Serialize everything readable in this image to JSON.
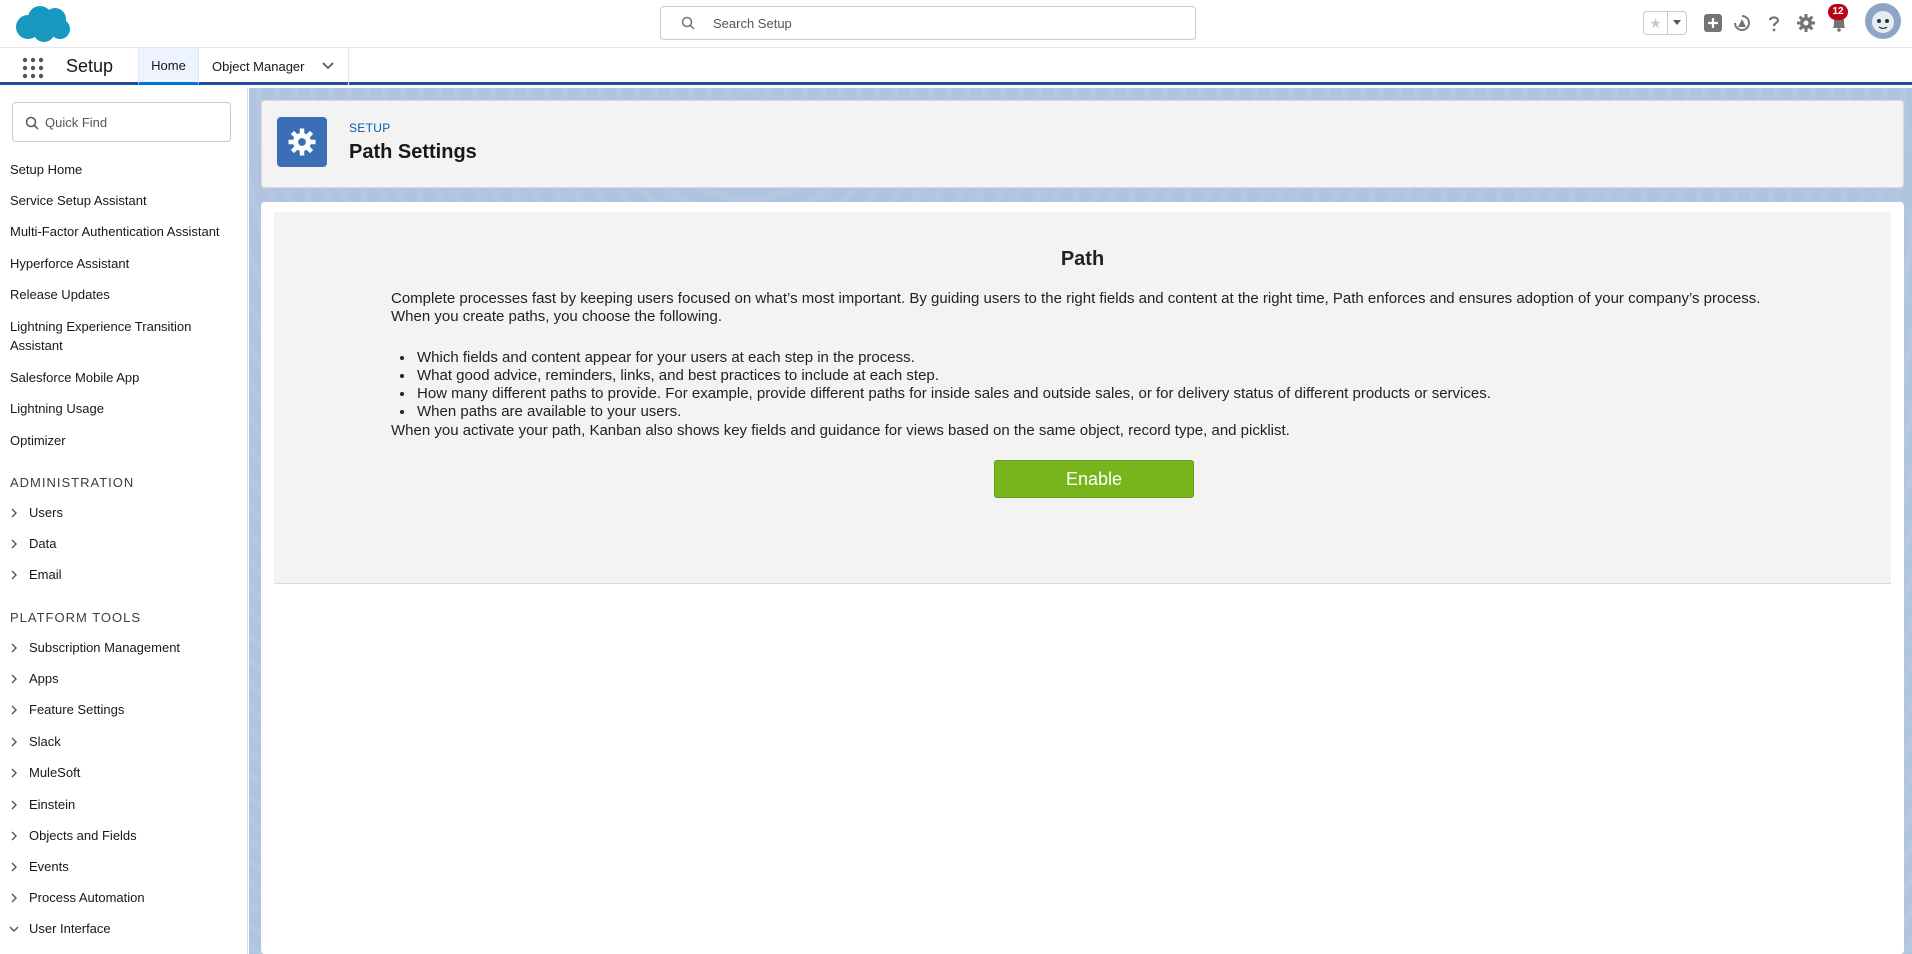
{
  "header": {
    "search_placeholder": "Search Setup",
    "notification_count": "12",
    "icons": [
      "salesforce-cloud-logo",
      "search-icon",
      "favorites-star-icon",
      "chevron-down-icon",
      "add-icon",
      "trailhead-icon",
      "help-icon",
      "gear-icon",
      "bell-icon",
      "avatar"
    ]
  },
  "app_nav": {
    "app_name": "Setup",
    "tabs": [
      {
        "label": "Home"
      },
      {
        "label": "Object Manager"
      }
    ]
  },
  "sidebar": {
    "quick_find_placeholder": "Quick Find",
    "links": [
      {
        "label": "Setup Home"
      },
      {
        "label": "Service Setup Assistant"
      },
      {
        "label": "Multi-Factor Authentication Assistant"
      },
      {
        "label": "Hyperforce Assistant"
      },
      {
        "label": "Release Updates"
      },
      {
        "label": "Lightning Experience Transition Assistant"
      },
      {
        "label": "Salesforce Mobile App"
      },
      {
        "label": "Lightning Usage"
      },
      {
        "label": "Optimizer"
      }
    ],
    "administration": {
      "heading": "ADMINISTRATION",
      "items": [
        {
          "label": "Users"
        },
        {
          "label": "Data"
        },
        {
          "label": "Email"
        }
      ]
    },
    "platform_tools": {
      "heading": "PLATFORM TOOLS",
      "items": [
        {
          "label": "Subscription Management"
        },
        {
          "label": "Apps"
        },
        {
          "label": "Feature Settings"
        },
        {
          "label": "Slack"
        },
        {
          "label": "MuleSoft"
        },
        {
          "label": "Einstein"
        },
        {
          "label": "Objects and Fields"
        },
        {
          "label": "Events"
        },
        {
          "label": "Process Automation"
        },
        {
          "label": "User Interface"
        }
      ]
    }
  },
  "page_header": {
    "eyebrow": "SETUP",
    "title": "Path Settings"
  },
  "path": {
    "title": "Path",
    "intro": "Complete processes fast by keeping users focused on what’s most important. By guiding users to the right fields and content at the right time, Path enforces and ensures adoption of your company’s process. When you create paths, you choose the following.",
    "bullets": [
      "Which fields and content appear for your users at each step in the process.",
      "What good advice, reminders, links, and best practices to include at each step.",
      "How many different paths to provide. For example, provide different paths for inside sales and outside sales, or for delivery status of different products or services.",
      "When paths are available to your users."
    ],
    "note": "When you activate your path, Kanban also shows key fields and guidance for views based on the same object, record type, and picklist.",
    "enable_label": "Enable"
  },
  "colors": {
    "brand_blue": "#0176d3",
    "nav_border": "#1b5297",
    "enable_green": "#78b51c",
    "badge_red": "#ba0517",
    "setup_icon_bg": "#3b6fb5"
  }
}
